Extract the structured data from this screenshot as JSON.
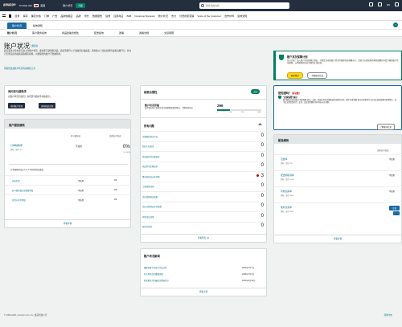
{
  "topbar": {
    "logo": "amazon",
    "logo_sub": "seller central",
    "store": "TOUGE INC",
    "country": "美国",
    "account_health": "账户状况",
    "upgrade": "升级",
    "search_placeholder": "搜索您的内容",
    "language": "EN"
  },
  "nav": {
    "items": [
      "目录",
      "库存",
      "确定价格",
      "订单",
      "广告",
      "品牌旗舰店",
      "品牌",
      "增长",
      "数据报告",
      "绩效",
      "应用商店",
      "B2B",
      "Customer Reviews",
      "账户状况",
      "支付",
      "付费搜索营销",
      "Voice of the Customer",
      "合作伙伴",
      "绩效通知"
    ]
  },
  "tabs": {
    "items": [
      "账户状况",
      "绩效通知"
    ]
  },
  "subtabs": {
    "items": [
      "账户状况",
      "客户服务绩效",
      "商品政策合规性",
      "配送绩效",
      "政策",
      "政策合规",
      "交货保障"
    ]
  },
  "header": {
    "title": "账户状况",
    "learn_more": "了解更多",
    "desc": "此页面显示您在亚马逊上的账户状况。要在亚马逊销售商品，您必须遵守以下绩效目标和政策。请查看以下指标和所有政策违规行为，并对它们所违反的政策采取相应措施，以确保您的账户不会被停用。",
    "link": "帮助您改进账户状况的资源和工具"
  },
  "promo": {
    "title": "账户状况保障计划",
    "text": "您已合格！加入账户状况保障计划后，只要您当前的账户状况评级保持在健康水平，您就可以提前获得风险提醒并享受专属的账户状况保障，从而帮助您的业务保持正常运营。",
    "btn1": "联系我们",
    "btn2": "了解更多信息"
  },
  "contact": {
    "title": "询问亚马逊助手",
    "text": "对账户状况有疑问？询问亚马逊助手获取指导。",
    "btn1": "询问账户状况",
    "btn2": "询问商品合规"
  },
  "cs": {
    "title": "客户服务绩效",
    "col1": "亚马逊配送",
    "col2": "卖家自行配送",
    "metric": "订单缺陷率",
    "metric_sub": "目标：低于 1%",
    "na1": "不适用",
    "big": "0%",
    "bigsub": "0 / 60 天",
    "odesc": "订单缺陷率由以下几个不同的指标组成：",
    "rows": [
      {
        "label": "负面反馈",
        "v1": "不适用",
        "v2": "0%"
      },
      {
        "label": "亚马逊商城交易保障索赔",
        "v1": "不适用",
        "v2": "0%"
      },
      {
        "label": "信用卡拒付索赔",
        "v1": "不适用",
        "v2": "0%"
      }
    ],
    "foot": "查看详情"
  },
  "policy": {
    "title": "政策合规性",
    "status": "良好",
    "rate_title": "账户状况评级",
    "rate_desc": "此评级反映了您遵守亚马逊销售政策的情况。了解更多信息",
    "score": "296",
    "bar_labels": [
      "0",
      "100",
      "200",
      "1000"
    ],
    "score_fraction": 0.29,
    "all_issues": "所有问题",
    "issues": [
      {
        "label": "涉嫌侵犯知识产权",
        "value": "0"
      },
      {
        "label": "知识产权投诉",
        "value": "0"
      },
      {
        "label": "商品真实性买家投诉",
        "value": "0"
      },
      {
        "label": "商品状况买家投诉",
        "value": "0"
      },
      {
        "label": "食品和商品安全问题",
        "value": "3"
      },
      {
        "label": "上架政策违规",
        "value": "0"
      },
      {
        "label": "违反受限商品政策",
        "value": "0"
      },
      {
        "label": "违反买家商品评论政策",
        "value": "0"
      },
      {
        "label": "其他违反政策",
        "value": "0"
      },
      {
        "label": "监管合规性",
        "value": "0"
      }
    ],
    "foot": "查看所有 (3)"
  },
  "news": {
    "title": "账户状况新闻",
    "rows": [
      {
        "text": "确保卖家平台账户的安全性",
        "date": "2026年7月7日"
      },
      {
        "text": "有关危险品的重要更新",
        "date": "2026年7月2日"
      },
      {
        "text": "新卖家首月的最佳实践和提示",
        "date": "2026年6月30日"
      }
    ],
    "foot": "查看全部"
  },
  "ntf": {
    "title": "您知道吗？",
    "new": "新功能！",
    "item_title": "\"卖家保障\"提示",
    "item_text": "我们很高兴宣布推出\"卖家保障\"提示，这是一项面向具有卓越绩效的卖家的计划。获得\"卖家保障\"提示的卖家将可以在违反某些政策时获得警告，而不会立即受到处罚。此外，还会提供额外的时间来纠正问题。",
    "more": "了解更多信息"
  },
  "ship": {
    "title": "配送绩效",
    "col": "卖家自行配送",
    "rows": [
      {
        "label": "迟发率",
        "sub": "目标：低于 4%",
        "value": "不适用"
      },
      {
        "label": "配送前取消率",
        "sub": "目标：低于 2.5%",
        "value": "不适用"
      },
      {
        "label": "有效追踪率",
        "sub": "目标：高于 95%",
        "value": "不适用"
      },
      {
        "label": "准时交货率",
        "sub": "目标：高于 90%",
        "value": "不适用"
      }
    ],
    "foot": "查看详情"
  },
  "feedback": "反馈",
  "footer": {
    "copy": "© 1999-2026, Amazon.com, Inc. 或其附属公司",
    "lang": "简体中文"
  }
}
